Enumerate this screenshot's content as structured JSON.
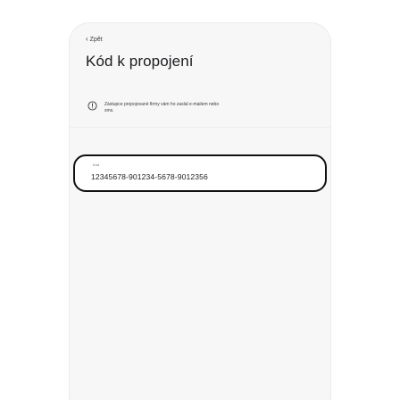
{
  "header": {
    "back_label": "Zpět",
    "title": "Kód k propojení"
  },
  "info": {
    "icon": "info-circle-icon",
    "text": "Zástupce propojované firmy vám ho zaslal e-mailem nebo sms."
  },
  "code_field": {
    "label": "Kód",
    "value": "12345678-901234-5678-9012356"
  },
  "colors": {
    "accent_border": "#111111",
    "screen_bg": "#f7f7f8",
    "text_primary": "#1c1c1e"
  }
}
